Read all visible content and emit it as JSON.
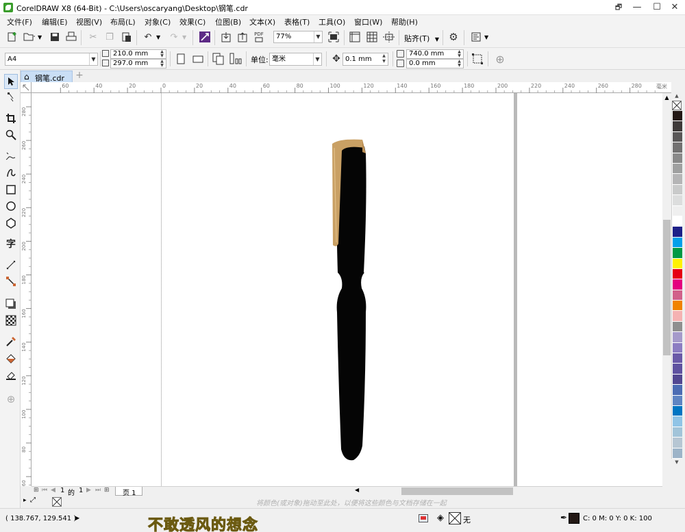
{
  "window": {
    "title": "CorelDRAW X8 (64-Bit) - C:\\Users\\oscaryang\\Desktop\\钢笔.cdr",
    "controls": [
      "🗗",
      "—",
      "☐",
      "✕"
    ]
  },
  "menu": [
    "文件(F)",
    "编辑(E)",
    "视图(V)",
    "布局(L)",
    "对象(C)",
    "效果(C)",
    "位图(B)",
    "文本(X)",
    "表格(T)",
    "工具(O)",
    "窗口(W)",
    "帮助(H)"
  ],
  "toolbar": {
    "zoom": "77%",
    "snap_label": "贴齐(T)",
    "pdf_label": "PDF"
  },
  "property_bar": {
    "page_size": "A4",
    "width": "210.0 mm",
    "height": "297.0 mm",
    "units_label": "单位:",
    "units_value": "毫米",
    "nudge": "0.1 mm",
    "dup_x": "740.0 mm",
    "dup_y": "0.0 mm"
  },
  "document_tab": {
    "label": "钢笔.cdr",
    "add": "+"
  },
  "rulers": {
    "h_ticks": [
      "60",
      "40",
      "20",
      "0",
      "20",
      "40",
      "60",
      "80",
      "100",
      "120",
      "140",
      "160",
      "180",
      "200",
      "220",
      "240",
      "260",
      "280"
    ],
    "h_unit": "毫米",
    "v_ticks": [
      "280",
      "260",
      "240",
      "220",
      "200",
      "180",
      "160",
      "140",
      "120",
      "100",
      "80",
      "60",
      "40",
      "20"
    ]
  },
  "page_nav": {
    "current": "1",
    "of_label": "的",
    "total": "1",
    "page_tab": "页 1"
  },
  "hint_text": "将颜色(或对象)拖动至此处，以便将这些颜色与文档存储在一起",
  "status": {
    "coords": "( 138.767, 129.541 )",
    "fill_none": "无",
    "color_readout": "C: 0 M: 0 Y: 0 K: 100"
  },
  "caption": "不敢透风的想念",
  "colors": {
    "accent": "#3a9d2b",
    "pen_body": "#050505",
    "pen_clip": "#c9a064",
    "caption_fill": "#f3d64a"
  },
  "palette": [
    "#231815",
    "#3e3a39",
    "#595757",
    "#727171",
    "#898989",
    "#9fa0a0",
    "#b5b5b6",
    "#c9caca",
    "#dcdddd",
    "#efefef",
    "#ffffff",
    "#1d2088",
    "#00a0e9",
    "#009944",
    "#fff100",
    "#e60012",
    "#e4007f",
    "#d1618a",
    "#f08300",
    "#f5b2b2",
    "#8f8f8f",
    "#a59aca",
    "#8c7dc2",
    "#6a5aa8",
    "#5f52a0",
    "#524791",
    "#4c6cb3",
    "#5e84c2",
    "#0075c2",
    "#90c4e6",
    "#a2c4d9",
    "#b6c6d3",
    "#9db4c8"
  ]
}
